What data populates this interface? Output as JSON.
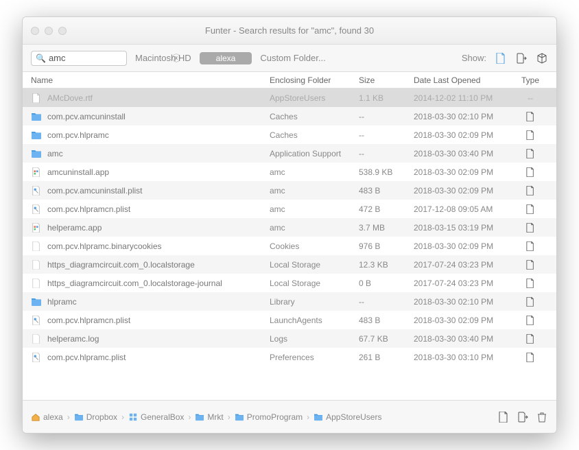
{
  "window": {
    "title": "Funter - Search results for \"amc\", found 30"
  },
  "toolbar": {
    "search": {
      "value": "amc"
    },
    "loc_macintosh": "Macintosh HD",
    "loc_pill": "alexa",
    "loc_custom": "Custom Folder...",
    "show_label": "Show:"
  },
  "columns": {
    "name": "Name",
    "folder": "Enclosing Folder",
    "size": "Size",
    "date": "Date Last Opened",
    "type": "Type"
  },
  "rows": [
    {
      "icon": "file",
      "name": "AMcDove.rtf",
      "folder": "AppStoreUsers",
      "size": "1.1 KB",
      "date": "2014-12-02 11:10 PM",
      "type": "--",
      "selected": true
    },
    {
      "icon": "folder",
      "name": "com.pcv.amcuninstall",
      "folder": "Caches",
      "size": "--",
      "date": "2018-03-30 02:10 PM",
      "type": "file"
    },
    {
      "icon": "folder",
      "name": "com.pcv.hlpramc",
      "folder": "Caches",
      "size": "--",
      "date": "2018-03-30 02:09 PM",
      "type": "file"
    },
    {
      "icon": "folder",
      "name": "amc",
      "folder": "Application Support",
      "size": "--",
      "date": "2018-03-30 03:40 PM",
      "type": "file"
    },
    {
      "icon": "app",
      "name": "amcuninstall.app",
      "folder": "amc",
      "size": "538.9 KB",
      "date": "2018-03-30 02:09 PM",
      "type": "file"
    },
    {
      "icon": "plist",
      "name": "com.pcv.amcuninstall.plist",
      "folder": "amc",
      "size": "483 B",
      "date": "2018-03-30 02:09 PM",
      "type": "file"
    },
    {
      "icon": "plist",
      "name": "com.pcv.hlpramcn.plist",
      "folder": "amc",
      "size": "472 B",
      "date": "2017-12-08 09:05 AM",
      "type": "file"
    },
    {
      "icon": "app",
      "name": "helperamc.app",
      "folder": "amc",
      "size": "3.7 MB",
      "date": "2018-03-15 03:19 PM",
      "type": "file"
    },
    {
      "icon": "blank",
      "name": "com.pcv.hlpramc.binarycookies",
      "folder": "Cookies",
      "size": "976 B",
      "date": "2018-03-30 02:09 PM",
      "type": "file"
    },
    {
      "icon": "blank",
      "name": "https_diagramcircuit.com_0.localstorage",
      "folder": "Local Storage",
      "size": "12.3 KB",
      "date": "2017-07-24 03:23 PM",
      "type": "file"
    },
    {
      "icon": "blank",
      "name": "https_diagramcircuit.com_0.localstorage-journal",
      "folder": "Local Storage",
      "size": "0 B",
      "date": "2017-07-24 03:23 PM",
      "type": "file"
    },
    {
      "icon": "folder",
      "name": "hlpramc",
      "folder": "Library",
      "size": "--",
      "date": "2018-03-30 02:10 PM",
      "type": "file"
    },
    {
      "icon": "plist",
      "name": "com.pcv.hlpramcn.plist",
      "folder": "LaunchAgents",
      "size": "483 B",
      "date": "2018-03-30 02:09 PM",
      "type": "file"
    },
    {
      "icon": "blank",
      "name": "helperamc.log",
      "folder": "Logs",
      "size": "67.7 KB",
      "date": "2018-03-30 03:40 PM",
      "type": "file"
    },
    {
      "icon": "plist",
      "name": "com.pcv.hlpramc.plist",
      "folder": "Preferences",
      "size": "261 B",
      "date": "2018-03-30 03:10 PM",
      "type": "file"
    }
  ],
  "breadcrumbs": [
    {
      "icon": "home",
      "label": "alexa"
    },
    {
      "icon": "folder",
      "label": "Dropbox"
    },
    {
      "icon": "grid",
      "label": "GeneralBox"
    },
    {
      "icon": "folder",
      "label": "Mrkt"
    },
    {
      "icon": "folder",
      "label": "PromoProgram"
    },
    {
      "icon": "folder",
      "label": "AppStoreUsers"
    }
  ]
}
